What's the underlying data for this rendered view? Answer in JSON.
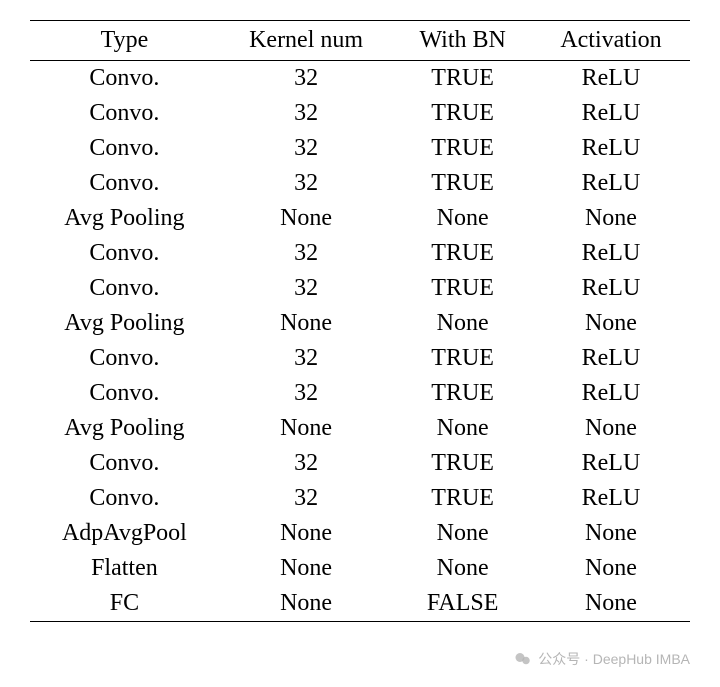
{
  "chart_data": {
    "type": "table",
    "columns": [
      "Type",
      "Kernel num",
      "With BN",
      "Activation"
    ],
    "rows": [
      [
        "Convo.",
        "32",
        "TRUE",
        "ReLU"
      ],
      [
        "Convo.",
        "32",
        "TRUE",
        "ReLU"
      ],
      [
        "Convo.",
        "32",
        "TRUE",
        "ReLU"
      ],
      [
        "Convo.",
        "32",
        "TRUE",
        "ReLU"
      ],
      [
        "Avg Pooling",
        "None",
        "None",
        "None"
      ],
      [
        "Convo.",
        "32",
        "TRUE",
        "ReLU"
      ],
      [
        "Convo.",
        "32",
        "TRUE",
        "ReLU"
      ],
      [
        "Avg Pooling",
        "None",
        "None",
        "None"
      ],
      [
        "Convo.",
        "32",
        "TRUE",
        "ReLU"
      ],
      [
        "Convo.",
        "32",
        "TRUE",
        "ReLU"
      ],
      [
        "Avg Pooling",
        "None",
        "None",
        "None"
      ],
      [
        "Convo.",
        "32",
        "TRUE",
        "ReLU"
      ],
      [
        "Convo.",
        "32",
        "TRUE",
        "ReLU"
      ],
      [
        "AdpAvgPool",
        "None",
        "None",
        "None"
      ],
      [
        "Flatten",
        "None",
        "None",
        "None"
      ],
      [
        "FC",
        "None",
        "FALSE",
        "None"
      ]
    ]
  },
  "watermark": "公众号 · DeepHub IMBA"
}
